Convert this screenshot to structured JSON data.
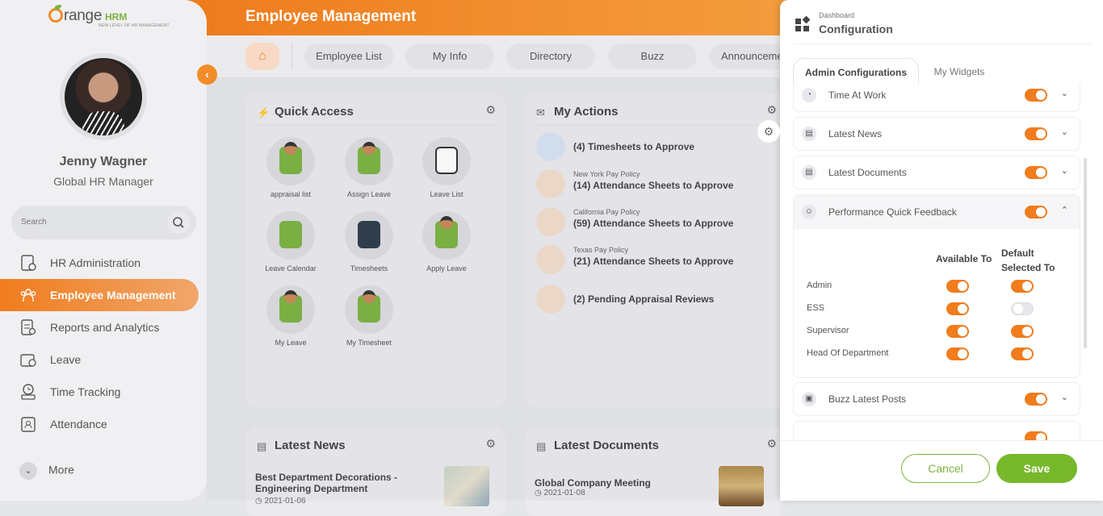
{
  "app": {
    "logo_text": "OrangeHRM",
    "logo_tagline": "NEW LEVEL OF HR MANAGEMENT"
  },
  "user": {
    "name": "Jenny Wagner",
    "role": "Global HR Manager"
  },
  "search": {
    "placeholder": "Search"
  },
  "sidebar": {
    "items": [
      {
        "label": "HR Administration",
        "icon": "hr-admin-icon"
      },
      {
        "label": "Employee Management",
        "icon": "employee-management-icon",
        "active": true
      },
      {
        "label": "Reports and Analytics",
        "icon": "reports-icon"
      },
      {
        "label": "Leave",
        "icon": "leave-icon"
      },
      {
        "label": "Time Tracking",
        "icon": "time-tracking-icon"
      },
      {
        "label": "Attendance",
        "icon": "attendance-icon"
      }
    ],
    "more_label": "More"
  },
  "header": {
    "title": "Employee Management"
  },
  "tabs": [
    "Employee List",
    "My Info",
    "Directory",
    "Buzz",
    "Announcements"
  ],
  "quick_access": {
    "title": "Quick Access",
    "items": [
      "appraisal list",
      "Assign Leave",
      "Leave List",
      "Leave Calendar",
      "Timesheets",
      "Apply Leave",
      "My Leave",
      "My Timesheet"
    ]
  },
  "my_actions": {
    "title": "My Actions",
    "items": [
      {
        "sub": "",
        "main": "(4) Timesheets to Approve"
      },
      {
        "sub": "New York Pay Policy",
        "main": "(14) Attendance Sheets to Approve"
      },
      {
        "sub": "California Pay Policy",
        "main": "(59) Attendance Sheets to Approve"
      },
      {
        "sub": "Texas Pay Policy",
        "main": "(21) Attendance Sheets to Approve"
      },
      {
        "sub": "",
        "main": "(2) Pending Appraisal Reviews"
      }
    ]
  },
  "latest_news": {
    "title": "Latest News",
    "item_title": "Best Department Decorations - Engineering Department",
    "item_date": "2021-01-06"
  },
  "latest_documents": {
    "title": "Latest Documents",
    "item_title": "Global Company Meeting",
    "item_date": "2021-01-08"
  },
  "config": {
    "breadcrumb": "Dashboard",
    "title": "Configuration",
    "tabs": {
      "admin": "Admin Configurations",
      "widgets": "My Widgets"
    },
    "widgets": [
      {
        "label": "Time At Work",
        "enabled": true
      },
      {
        "label": "Latest News",
        "enabled": true
      },
      {
        "label": "Latest Documents",
        "enabled": true
      },
      {
        "label": "Performance Quick Feedback",
        "enabled": true
      },
      {
        "label": "Buzz Latest Posts",
        "enabled": true
      }
    ],
    "columns": {
      "available": "Available To",
      "default": "Default Selected To"
    },
    "roles": [
      {
        "name": "Admin",
        "available": true,
        "default": true
      },
      {
        "name": "ESS",
        "available": true,
        "default": false
      },
      {
        "name": "Supervisor",
        "available": true,
        "default": true
      },
      {
        "name": "Head Of Department",
        "available": true,
        "default": true
      }
    ],
    "cancel_label": "Cancel",
    "save_label": "Save"
  },
  "colors": {
    "accent": "#f07c1d",
    "save": "#76b82a"
  }
}
